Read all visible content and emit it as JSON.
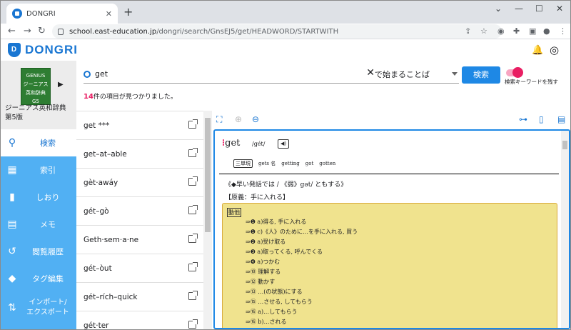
{
  "browser": {
    "tab_title": "DONGRI",
    "url_host": "school.east-education.jp",
    "url_path": "/dongri/search/GnsEJ5/get/HEADWORD/STARTWITH"
  },
  "app": {
    "logo": "DONGRI"
  },
  "book": {
    "cover_line1": "GENIUS",
    "cover_line2": "ジーニアス",
    "cover_line3": "英和辞典",
    "cover_line4": "G5",
    "name_line1": "ジーニアス英和辞典",
    "name_line2": "第5版"
  },
  "menu": [
    {
      "icon": "search-icon",
      "label": "検索"
    },
    {
      "icon": "grid-icon",
      "label": "索引"
    },
    {
      "icon": "bookmark-icon",
      "label": "しおり"
    },
    {
      "icon": "memo-icon",
      "label": "メモ"
    },
    {
      "icon": "history-icon",
      "label": "閲覧履歴"
    },
    {
      "icon": "tag-icon",
      "label": "タグ編集"
    },
    {
      "icon": "import-export-icon",
      "label": "インポート/エクスポート"
    }
  ],
  "search": {
    "query": "get",
    "mode": "で始まることば",
    "button": "検索",
    "keep_label": "検索キーワードを残す"
  },
  "results": {
    "count": "14",
    "count_suffix": "件の項目が見つかりました。",
    "items": [
      "get ***",
      "get–at–able",
      "gèt·awáy",
      "gét–gò",
      "Geth·sem·a·ne",
      "gét–òut",
      "gét–rích–quick",
      "gét·ter"
    ]
  },
  "entry": {
    "headword": "get",
    "pron": "/gét/",
    "forms": [
      "三単現",
      "gets 名",
      "getting",
      "got",
      "gotten"
    ],
    "etymology": "《◆早い発話では / 《弱》gət/ ともする》",
    "origin": "【原義：手に入れる】",
    "header": "動他",
    "senses": [
      "⇒❶ a)得る, 手に入れる",
      "⇒❶ c)《人》のために…を手に入れる, 買う",
      "⇒❷ a)受け取る",
      "⇒❸ a)取ってくる, 呼んでくる",
      "⇒❹ a)つかむ",
      "⇒⑩ 理解する",
      "⇒⑫ 動かす",
      "⇒⑬ …(の状態)にする",
      "⇒⑮ …させる, してもらう",
      "⇒⑯ a)…してもらう",
      "⇒⑯ b)…される"
    ]
  }
}
